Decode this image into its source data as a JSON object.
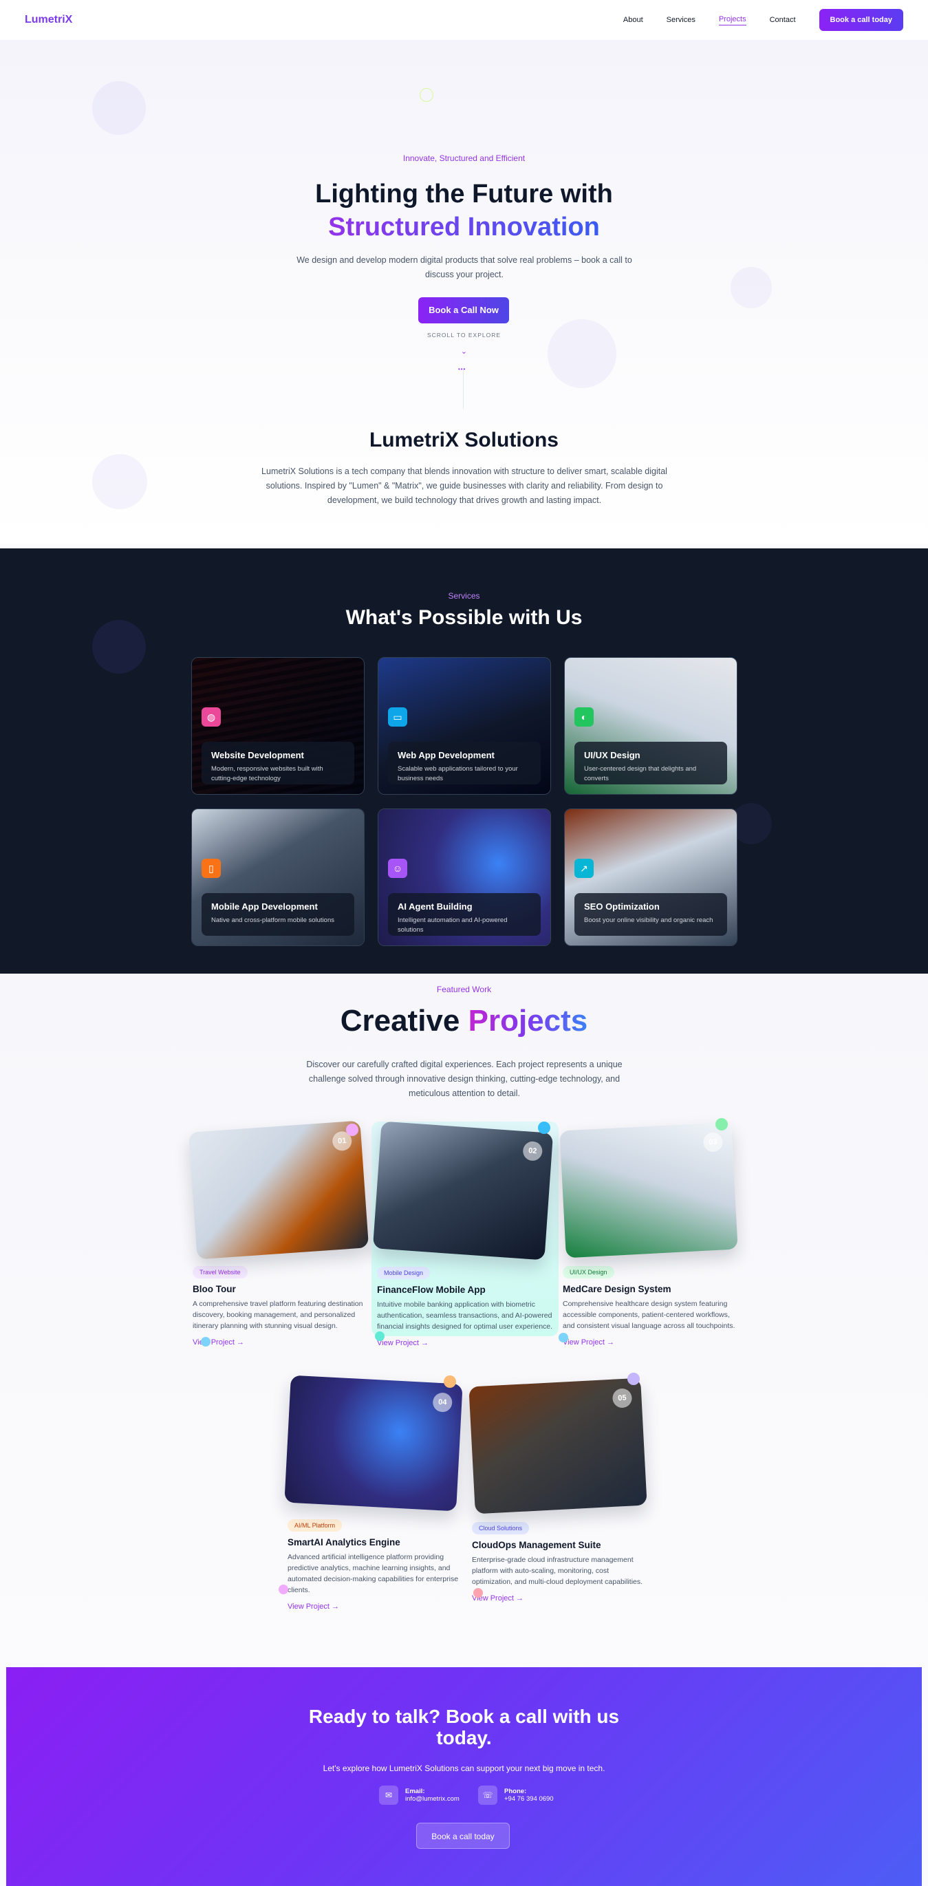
{
  "nav": {
    "logo": "LumetriX",
    "links": [
      {
        "label": "About",
        "active": false
      },
      {
        "label": "Services",
        "active": false
      },
      {
        "label": "Projects",
        "active": true
      },
      {
        "label": "Contact",
        "active": false
      }
    ],
    "cta": "Book a call today"
  },
  "hero": {
    "eyebrow": "Innovate, Structured and Efficient",
    "title_line1": "Lighting the Future with",
    "title_line2": "Structured Innovation",
    "subtitle": "We design and develop modern digital products that solve real problems – book a call to discuss your project.",
    "cta": "Book a Call Now",
    "scroll_label": "SCROLL TO EXPLORE",
    "scroll_icon": "chevron-down-icon"
  },
  "about": {
    "title": "LumetriX Solutions",
    "body": "LumetriX Solutions is a tech company that blends innovation with structure to deliver smart, scalable digital solutions. Inspired by \"Lumen\" & \"Matrix\", we guide businesses with clarity and reliability. From design to development, we build technology that drives growth and lasting impact."
  },
  "services": {
    "eyebrow": "Services",
    "title": "What's Possible with Us",
    "items": [
      {
        "title": "Website Development",
        "desc": "Modern, responsive websites built with cutting-edge technology",
        "icon": "globe-icon",
        "color": "#ec4899"
      },
      {
        "title": "Web App Development",
        "desc": "Scalable web applications tailored to your business needs",
        "icon": "monitor-icon",
        "color": "#0ea5e9"
      },
      {
        "title": "UI/UX Design",
        "desc": "User-centered design that delights and converts",
        "icon": "palette-icon",
        "color": "#22c55e"
      },
      {
        "title": "Mobile App Development",
        "desc": "Native and cross-platform mobile solutions",
        "icon": "smartphone-icon",
        "color": "#f97316"
      },
      {
        "title": "AI Agent Building",
        "desc": "Intelligent automation and AI-powered solutions",
        "icon": "bot-icon",
        "color": "#a855f7"
      },
      {
        "title": "SEO Optimization",
        "desc": "Boost your online visibility and organic reach",
        "icon": "trending-up-icon",
        "color": "#06b6d4"
      }
    ]
  },
  "projects": {
    "eyebrow": "Featured Work",
    "title_a": "Creative",
    "title_b": "Projects",
    "subtitle": "Discover our carefully crafted digital experiences. Each project represents a unique challenge solved through innovative design thinking, cutting-edge technology, and meticulous attention to detail.",
    "items": [
      {
        "num": "01",
        "badge": "Travel Website",
        "title": "Bloo Tour",
        "desc": "A comprehensive travel platform featuring destination discovery, booking management, and personalized itinerary planning with stunning visual design.",
        "link": "View Project →",
        "badge_bg": "#f3e8ff",
        "badge_fg": "#9333ea"
      },
      {
        "num": "02",
        "badge": "Mobile Design",
        "title": "FinanceFlow Mobile App",
        "desc": "Intuitive mobile banking application with biometric authentication, seamless transactions, and AI-powered financial insights designed for optimal user experience.",
        "link": "View Project →",
        "badge_bg": "#e0e7ff",
        "badge_fg": "#4f46e5"
      },
      {
        "num": "03",
        "badge": "UI/UX Design",
        "title": "MedCare Design System",
        "desc": "Comprehensive healthcare design system featuring accessible components, patient-centered workflows, and consistent visual language across all touchpoints.",
        "link": "View Project →",
        "badge_bg": "#dcfce7",
        "badge_fg": "#15803d"
      },
      {
        "num": "04",
        "badge": "AI/ML Platform",
        "title": "SmartAI Analytics Engine",
        "desc": "Advanced artificial intelligence platform providing predictive analytics, machine learning insights, and automated decision-making capabilities for enterprise clients.",
        "link": "View Project →",
        "badge_bg": "#ffedd5",
        "badge_fg": "#c2410c"
      },
      {
        "num": "05",
        "badge": "Cloud Solutions",
        "title": "CloudOps Management Suite",
        "desc": "Enterprise-grade cloud infrastructure management platform with auto-scaling, monitoring, cost optimization, and multi-cloud deployment capabilities.",
        "link": "View Project →",
        "badge_bg": "#e0e7ff",
        "badge_fg": "#4f46e5"
      }
    ]
  },
  "cta": {
    "title": "Ready to talk? Book a call with us today.",
    "subtitle": "Let's explore how LumetriX Solutions can support your next big move in tech.",
    "email_label": "Email:",
    "email_value": "info@lumetrix.com",
    "phone_label": "Phone:",
    "phone_value": "+94 76 394 0690",
    "button": "Book a call today"
  }
}
